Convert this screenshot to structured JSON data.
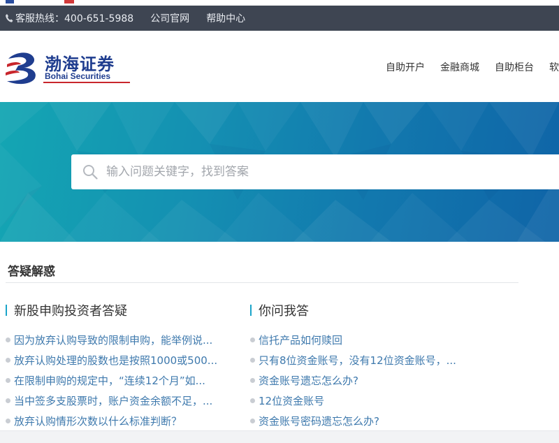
{
  "util_bar": {
    "hotline": "客服热线：400-651-5988",
    "links": [
      "公司官网",
      "帮助中心"
    ]
  },
  "logo": {
    "cn_name": "渤海证券",
    "en_name": "Bohai Securities"
  },
  "nav": {
    "items": [
      "自助开户",
      "金融商城",
      "自助柜台",
      "软件"
    ]
  },
  "search": {
    "placeholder": "输入问题关键字，找到答案"
  },
  "qa": {
    "title": "答疑解惑",
    "left": {
      "title": "新股申购投资者答疑",
      "items": [
        "因为放弃认购导致的限制申购，能举例说...",
        "放弃认购处理的股数也是按照1000或500...",
        "在限制申购的规定中，“连续12个月”如...",
        "当中签多支股票时，账户资金余额不足，...",
        "放弃认购情形次数以什么标准判断？"
      ]
    },
    "right": {
      "title": "你问我答",
      "items": [
        "信托产品如何赎回",
        "只有8位资金账号，没有12位资金账号，...",
        "资金账号遗忘怎么办?",
        "12位资金账号",
        "资金账号密码遗忘怎么办?"
      ]
    }
  },
  "colors": {
    "util_bar_bg": "#3e4552",
    "brand_blue": "#1f3d8f",
    "link_blue": "#3e79ad",
    "accent_teal": "#1aa4c9"
  },
  "icons": [
    "phone-icon",
    "search-icon"
  ]
}
